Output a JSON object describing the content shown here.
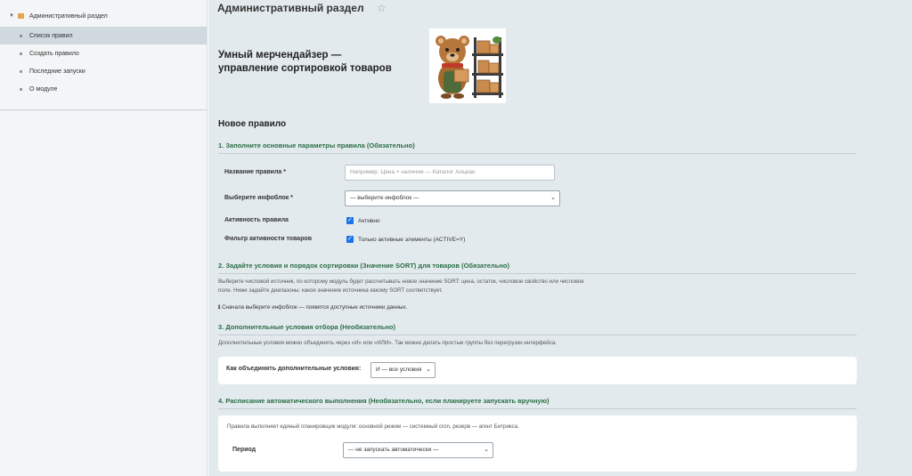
{
  "sidebar": {
    "root_label": "Административный раздел",
    "items": [
      {
        "label": "Список правил",
        "active": true
      },
      {
        "label": "Создать правило",
        "active": false
      },
      {
        "label": "Последние запуски",
        "active": false
      },
      {
        "label": "О модуле",
        "active": false
      }
    ]
  },
  "header": {
    "title": "Административный раздел"
  },
  "banner": {
    "title_line1": "Умный мерчендайзер —",
    "title_line2": "управление сортировкой товаров"
  },
  "form": {
    "title": "Новое правило",
    "section1": {
      "heading": "1. Заполните основные параметры правила (Обязательно)",
      "name_label": "Название правила *",
      "name_placeholder": "Например: Цена + наличие — Каталог Альран",
      "iblock_label": "Выберите инфоблок *",
      "iblock_value": "— выберите инфоблок —",
      "active_label": "Активность правила",
      "active_checkbox_label": "Активно",
      "filter_label": "Фильтр активности товаров",
      "filter_checkbox_label": "Только активные элементы (ACTIVE=Y)"
    },
    "section2": {
      "heading": "2. Задайте условия и порядок сортировки (Значение SORT) для товаров (Обязательно)",
      "note_line1": "Выберите числовой источник, по которому модуль будет рассчитывать новое значение SORT: цена, остаток, числовое свойство или числовое",
      "note_line2": "поле. Ниже задайте диапазоны: какое значение источника какому SORT соответствует.",
      "info": "Сначала выберите инфоблок — появятся доступные источники данных."
    },
    "section3": {
      "heading": "3. Дополнительные условия отбора (Необязательно)",
      "note": "Дополнительные условия можно объединять через «И» или «ИЛИ». Так можно делать простые группы без перегрузки интерфейса.",
      "combine_label": "Как объединять дополнительные условия:",
      "combine_value": "И — все условия"
    },
    "section4": {
      "heading": "4. Расписание автоматического выполнения (Необязательно, если планируете запускать вручную)",
      "note": "Правила выполняет единый планировщик модуля: основной режим — системный cron, резерв — агент Битрикса.",
      "period_label": "Период",
      "period_value": "— не запускать автоматически —"
    }
  },
  "icons": {
    "star": "star-icon",
    "folder": "folder-icon",
    "checkbox": "checkbox-icon"
  },
  "colors": {
    "section_heading": "#2a6e45",
    "checkbox": "#1a73e8",
    "main_bg": "#e3eaee",
    "active_item_bg": "#cfd9df"
  }
}
